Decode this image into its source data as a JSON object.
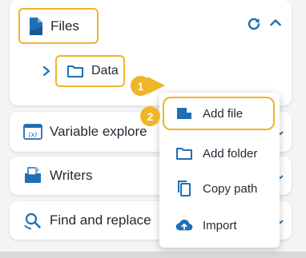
{
  "colors": {
    "accent": "#1f6fb2",
    "highlight": "#f0b429",
    "text": "#1f2933"
  },
  "files_panel": {
    "title": "Files",
    "title_icon": "file-icon",
    "refresh_icon": "refresh-icon",
    "collapse_icon": "chevron-up-icon",
    "tree": {
      "expand_icon": "chevron-right-icon",
      "folder_icon": "folder-icon",
      "folder_label": "Data"
    }
  },
  "panels": [
    {
      "label": "Variable explore",
      "icon": "variable-explorer-icon"
    },
    {
      "label": "Writers",
      "icon": "writers-icon"
    },
    {
      "label": "Find and replace",
      "icon": "find-replace-icon"
    }
  ],
  "callouts": {
    "step1": "1",
    "step2": "2"
  },
  "context_menu": {
    "items": [
      {
        "label": "Add file",
        "icon": "add-file-icon"
      },
      {
        "label": "Add folder",
        "icon": "add-folder-icon"
      },
      {
        "label": "Copy path",
        "icon": "copy-icon"
      },
      {
        "label": "Import",
        "icon": "cloud-upload-icon"
      }
    ]
  }
}
